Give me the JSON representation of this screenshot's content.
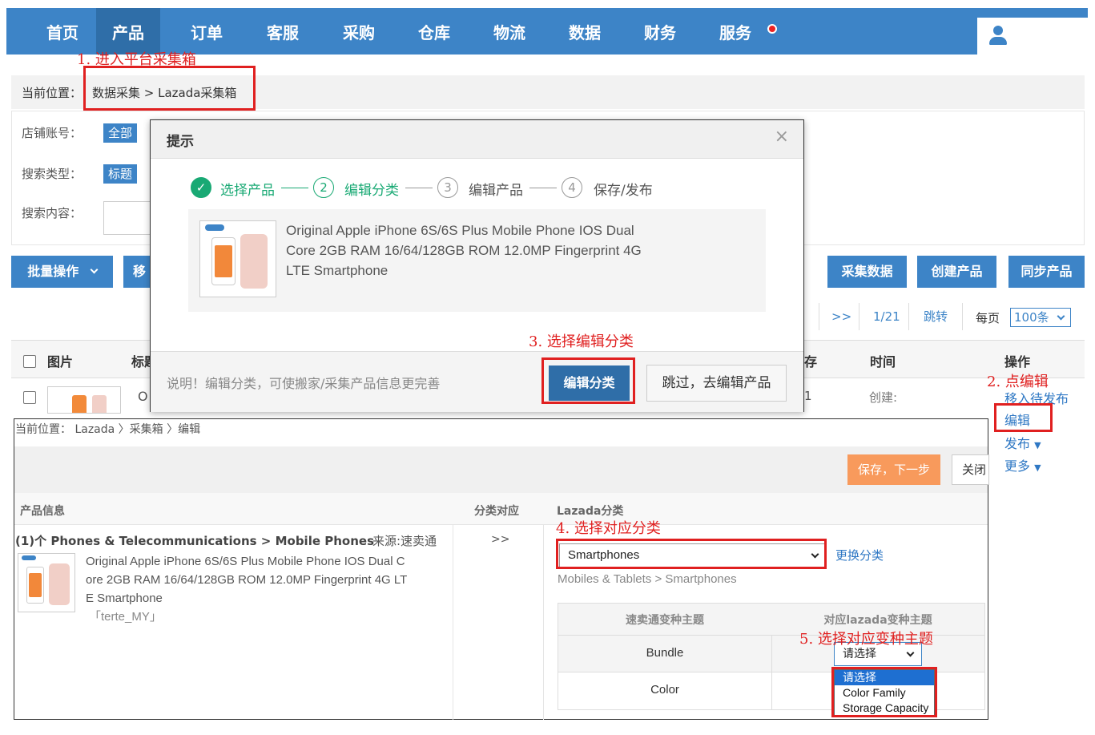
{
  "nav": {
    "items": [
      "首页",
      "产品",
      "订单",
      "客服",
      "采购",
      "仓库",
      "物流",
      "数据",
      "财务",
      "服务"
    ],
    "active_index": 1
  },
  "annotations": {
    "step1": "1. 进入平台采集箱",
    "step2": "2. 点编辑",
    "step3": "3. 选择编辑分类",
    "step4": "4. 选择对应分类",
    "step5": "5. 选择对应变种主题"
  },
  "breadcrumb": {
    "label": "当前位置：",
    "path": "数据采集 > Lazada采集箱"
  },
  "filters": {
    "shop_label": "店铺账号：",
    "shop_value": "全部",
    "search_type_label": "搜索类型：",
    "search_type_value": "标题",
    "search_content_label": "搜索内容："
  },
  "toolbar": {
    "batch_label": "批量操作",
    "move_label": "移",
    "collect_label": "采集数据",
    "create_label": "创建产品",
    "sync_label": "同步产品"
  },
  "pager": {
    "next": ">>",
    "page": "1/21",
    "jump": "跳转",
    "per_page_label": "每页",
    "per_page_value": "100条"
  },
  "list": {
    "col_image": "图片",
    "col_title": "标题",
    "col_stock": "存",
    "col_time": "时间",
    "col_action": "操作",
    "row_title_start": "O",
    "row_stock": "1",
    "row_time": "创建:",
    "actions": [
      "移入待发布",
      "编辑",
      "发布",
      "更多"
    ]
  },
  "modal": {
    "title": "提示",
    "close": "×",
    "steps": [
      {
        "num": "✓",
        "label": "选择产品"
      },
      {
        "num": "2",
        "label": "编辑分类"
      },
      {
        "num": "3",
        "label": "编辑产品"
      },
      {
        "num": "4",
        "label": "保存/发布"
      }
    ],
    "product_line1": "Original Apple iPhone 6S/6S Plus Mobile Phone IOS Dual",
    "product_line2": "Core 2GB RAM 16/64/128GB ROM 12.0MP Fingerprint 4G",
    "product_line3": "LTE Smartphone",
    "note": "说明！编辑分类，可使搬家/采集产品信息更完善",
    "edit_category_button": "编辑分类",
    "skip_button": "跳过，去编辑产品"
  },
  "edit": {
    "breadcrumb": "当前位置：  Lazada  〉采集箱 〉编辑",
    "save_next_button": "保存，下一步",
    "close_button": "关闭",
    "col_product_info": "产品信息",
    "col_mapping": "分类对应",
    "col_lazada": "Lazada分类",
    "category_path": "(1)个 Phones & Telecommunications > Mobile Phones",
    "source": "来源:速卖通",
    "arrow": ">>",
    "product_line1": "Original Apple iPhone 6S/6S Plus Mobile Phone IOS Dual C",
    "product_line2": "ore 2GB RAM 16/64/128GB ROM 12.0MP Fingerprint 4G LT",
    "product_line3": "E Smartphone",
    "store": "「terte_MY」",
    "category_select": "Smartphones",
    "change_category": "更换分类",
    "category_breadcrumb": "Mobiles & Tablets > Smartphones",
    "variant_head_left": "速卖通变种主题",
    "variant_head_right": "对应lazada变种主题",
    "variant_rows": [
      "Bundle",
      "Color"
    ],
    "variant_select": "请选择",
    "dropdown_options": [
      "请选择",
      "Color Family",
      "Storage Capacity"
    ]
  }
}
